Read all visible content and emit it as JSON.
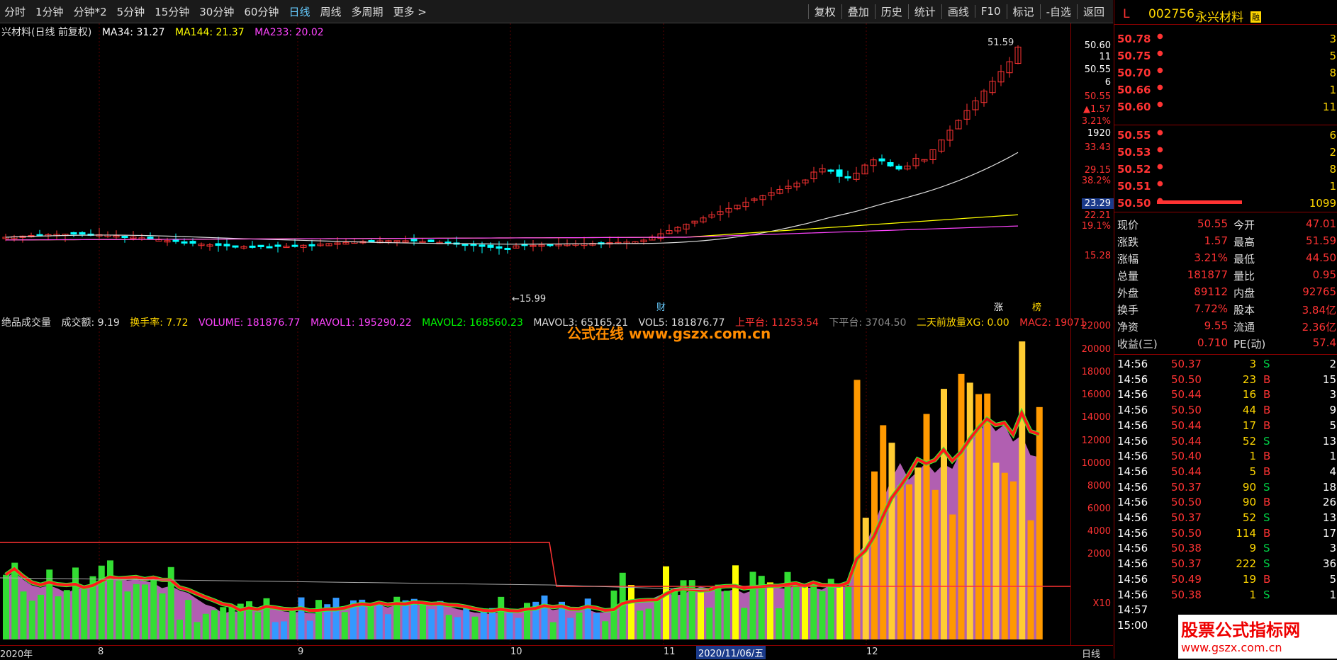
{
  "toolbar": {
    "left": [
      "分时",
      "1分钟",
      "分钟*2",
      "5分钟",
      "15分钟",
      "30分钟",
      "60分钟",
      "日线",
      "周线",
      "多周期",
      "更多 >"
    ],
    "right": [
      "复权",
      "叠加",
      "历史",
      "统计",
      "画线",
      "F10",
      "标记",
      "-自选",
      "返回"
    ]
  },
  "main_legend": {
    "title": "兴材料(日线 前复权)",
    "ma34": "MA34: 31.27",
    "ma144": "MA144: 21.37",
    "ma233": "MA233: 20.02"
  },
  "main_annotations": {
    "high": "51.59",
    "low": "15.99",
    "cai": "财",
    "zhang": "涨",
    "bang": "榜"
  },
  "price_axis": {
    "upper": [
      "50.60",
      "11",
      "50.55",
      "6",
      "50.55",
      "▲1.57",
      "3.21%",
      "1920",
      "33.43",
      "29.15",
      "38.2%",
      "23.29",
      "22.21",
      "19.1%",
      "15.28"
    ],
    "volume": [
      "22000",
      "20000",
      "18000",
      "16000",
      "14000",
      "12000",
      "10000",
      "8000",
      "6000",
      "4000",
      "2000",
      "X10"
    ]
  },
  "vol_legend": {
    "name": "绝品成交量",
    "amount": "成交额: 9.19",
    "turnover": "换手率: 7.72",
    "volume": "VOLUME: 181876.77",
    "mavol1": "MAVOL1: 195290.22",
    "mavol2": "MAVOL2: 168560.23",
    "mavol3": "MAVOL3: 65165.21",
    "vol": "VOL5: 181876.77",
    "up": "上平台: 11253.54",
    "down": "下平台: 3704.50",
    "xg": "二天前放量XG: 0.00",
    "mac2": "MAC2: 19071"
  },
  "watermark": {
    "center": "公式在线 www.gszx.com.cn",
    "corner_top": "股票公式指标网",
    "corner_bottom": "www.gszx.com.cn"
  },
  "date_axis": {
    "labels": [
      "2020年",
      "8",
      "9",
      "10",
      "11",
      "12"
    ],
    "cursor": "2020/11/06/五",
    "period": "日线"
  },
  "stock": {
    "code_prefix": "L",
    "code": "002756",
    "name": "永兴材料",
    "tag": "融"
  },
  "asks": [
    {
      "price": "50.78",
      "vol": "3"
    },
    {
      "price": "50.75",
      "vol": "5"
    },
    {
      "price": "50.70",
      "vol": "8"
    },
    {
      "price": "50.66",
      "vol": "1"
    },
    {
      "price": "50.60",
      "vol": "11"
    }
  ],
  "bids": [
    {
      "price": "50.55",
      "vol": "6"
    },
    {
      "price": "50.53",
      "vol": "2"
    },
    {
      "price": "50.52",
      "vol": "8"
    },
    {
      "price": "50.51",
      "vol": "1"
    },
    {
      "price": "50.50",
      "vol": "1099"
    }
  ],
  "quote": [
    {
      "l1": "现价",
      "v1": "50.55",
      "l2": "今开",
      "v2": "47.01"
    },
    {
      "l1": "涨跌",
      "v1": "1.57",
      "l2": "最高",
      "v2": "51.59"
    },
    {
      "l1": "涨幅",
      "v1": "3.21%",
      "l2": "最低",
      "v2": "44.50"
    },
    {
      "l1": "总量",
      "v1": "181877",
      "l2": "量比",
      "v2": "0.95"
    },
    {
      "l1": "外盘",
      "v1": "89112",
      "l2": "内盘",
      "v2": "92765"
    },
    {
      "l1": "换手",
      "v1": "7.72%",
      "l2": "股本",
      "v2": "3.84亿"
    },
    {
      "l1": "净资",
      "v1": "9.55",
      "l2": "流通",
      "v2": "2.36亿"
    },
    {
      "l1": "收益(三)",
      "v1": "0.710",
      "l2": "PE(动)",
      "v2": "57.4"
    }
  ],
  "trades": [
    {
      "t": "14:56",
      "p": "50.37",
      "v": "3",
      "s": "S",
      "n": "2"
    },
    {
      "t": "14:56",
      "p": "50.50",
      "v": "23",
      "s": "B",
      "n": "15"
    },
    {
      "t": "14:56",
      "p": "50.44",
      "v": "16",
      "s": "B",
      "n": "3"
    },
    {
      "t": "14:56",
      "p": "50.50",
      "v": "44",
      "s": "B",
      "n": "9"
    },
    {
      "t": "14:56",
      "p": "50.44",
      "v": "17",
      "s": "B",
      "n": "5"
    },
    {
      "t": "14:56",
      "p": "50.44",
      "v": "52",
      "s": "S",
      "n": "13"
    },
    {
      "t": "14:56",
      "p": "50.40",
      "v": "1",
      "s": "B",
      "n": "1"
    },
    {
      "t": "14:56",
      "p": "50.44",
      "v": "5",
      "s": "B",
      "n": "4"
    },
    {
      "t": "14:56",
      "p": "50.37",
      "v": "90",
      "s": "S",
      "n": "18"
    },
    {
      "t": "14:56",
      "p": "50.50",
      "v": "90",
      "s": "B",
      "n": "26"
    },
    {
      "t": "14:56",
      "p": "50.37",
      "v": "52",
      "s": "S",
      "n": "13"
    },
    {
      "t": "14:56",
      "p": "50.50",
      "v": "114",
      "s": "B",
      "n": "17"
    },
    {
      "t": "14:56",
      "p": "50.38",
      "v": "9",
      "s": "S",
      "n": "3"
    },
    {
      "t": "14:56",
      "p": "50.37",
      "v": "222",
      "s": "S",
      "n": "36"
    },
    {
      "t": "14:56",
      "p": "50.49",
      "v": "19",
      "s": "B",
      "n": "5"
    },
    {
      "t": "14:56",
      "p": "50.38",
      "v": "1",
      "s": "S",
      "n": "1"
    },
    {
      "t": "14:57",
      "p": "",
      "v": "",
      "s": "",
      "n": ""
    },
    {
      "t": "15:00",
      "p": "",
      "v": "",
      "s": "",
      "n": ""
    }
  ],
  "colors": {
    "up": "#ff3333",
    "down": "#00ffff",
    "ma34": "#ffffff",
    "ma144": "#ffff00",
    "ma233": "#ff00ff"
  }
}
